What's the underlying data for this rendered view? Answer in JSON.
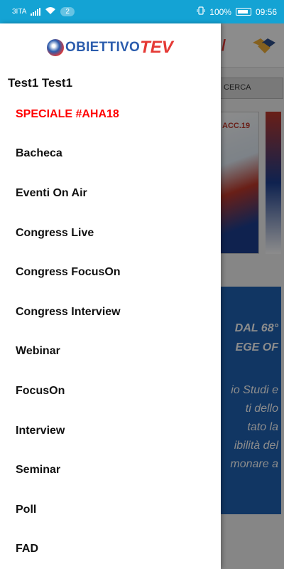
{
  "status_bar": {
    "carrier": "3ITA",
    "notification_count": "2",
    "battery": "100%",
    "time": "09:56"
  },
  "background": {
    "search_button": "CERCA",
    "banner_label": "ACC.19",
    "card_lines": [
      "DAL 68°",
      "EGE OF",
      "io Studi e",
      "ti dello",
      "tato la",
      "ibilità del",
      "monare a"
    ]
  },
  "drawer": {
    "logo": {
      "word": "OBIETTIVO",
      "tev": "TEV"
    },
    "user_name": "Test1 Test1",
    "menu_items": [
      {
        "label": "SPECIALE #AHA18"
      },
      {
        "label": "Bacheca"
      },
      {
        "label": "Eventi On Air"
      },
      {
        "label": "Congress Live"
      },
      {
        "label": "Congress FocusOn"
      },
      {
        "label": "Congress Interview"
      },
      {
        "label": "Webinar"
      },
      {
        "label": "FocusOn"
      },
      {
        "label": "Interview"
      },
      {
        "label": "Seminar"
      },
      {
        "label": "Poll"
      },
      {
        "label": "FAD"
      }
    ]
  },
  "colors": {
    "status_bar": "#14a3d4",
    "special_item": "#ff0000",
    "logo_blue": "#2b5cad",
    "logo_red": "#e53935"
  }
}
